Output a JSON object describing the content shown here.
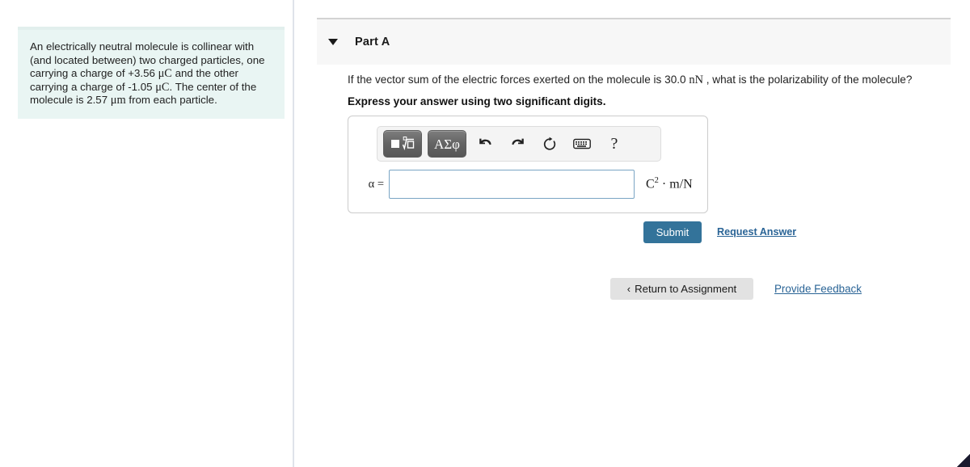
{
  "problem": {
    "text_part1": "An electrically neutral molecule is collinear with (and located between) two charged particles, one carrying a charge of +3.56 ",
    "unit1": "μC",
    "text_part2": " and the other carrying a charge of -1.05 ",
    "unit2": "μC",
    "text_part3": ". The center of the molecule is 2.57 ",
    "unit3": "μm",
    "text_part4": " from each particle."
  },
  "part": {
    "title": "Part A",
    "collapse_icon": "triangle-down-icon"
  },
  "question": {
    "text_before": "If the vector sum of the electric forces exerted on the molecule is 30.0 ",
    "force_unit": "nN",
    "text_after": " , what is the polarizability of the molecule?",
    "instruction": "Express your answer using two significant digits."
  },
  "toolbar": {
    "items": [
      {
        "name": "math-template-button",
        "type": "template",
        "label": ""
      },
      {
        "name": "greek-symbols-button",
        "type": "greek",
        "label": "ΑΣφ"
      },
      {
        "name": "undo-icon",
        "type": "icon",
        "label": "undo"
      },
      {
        "name": "redo-icon",
        "type": "icon",
        "label": "redo"
      },
      {
        "name": "reset-icon",
        "type": "icon",
        "label": "reset"
      },
      {
        "name": "keyboard-icon",
        "type": "icon",
        "label": "keyboard"
      },
      {
        "name": "help-icon",
        "type": "icon",
        "label": "?"
      }
    ],
    "help_glyph": "?"
  },
  "answer": {
    "variable_label": "α =",
    "value": "",
    "placeholder": "",
    "units_base": "C",
    "units_exponent": "2",
    "units_rest": " · m/N"
  },
  "actions": {
    "submit_label": "Submit",
    "request_answer_label": "Request Answer",
    "return_label": "Return to Assignment",
    "return_chevron": "‹",
    "provide_feedback_label": "Provide Feedback"
  },
  "colors": {
    "submit_bg": "#33739a",
    "link": "#2a6496",
    "problem_bg": "#e9f5f3",
    "header_bg": "#f7f7f7",
    "return_bg": "#e2e2e2",
    "input_border": "#7aa5c4"
  }
}
